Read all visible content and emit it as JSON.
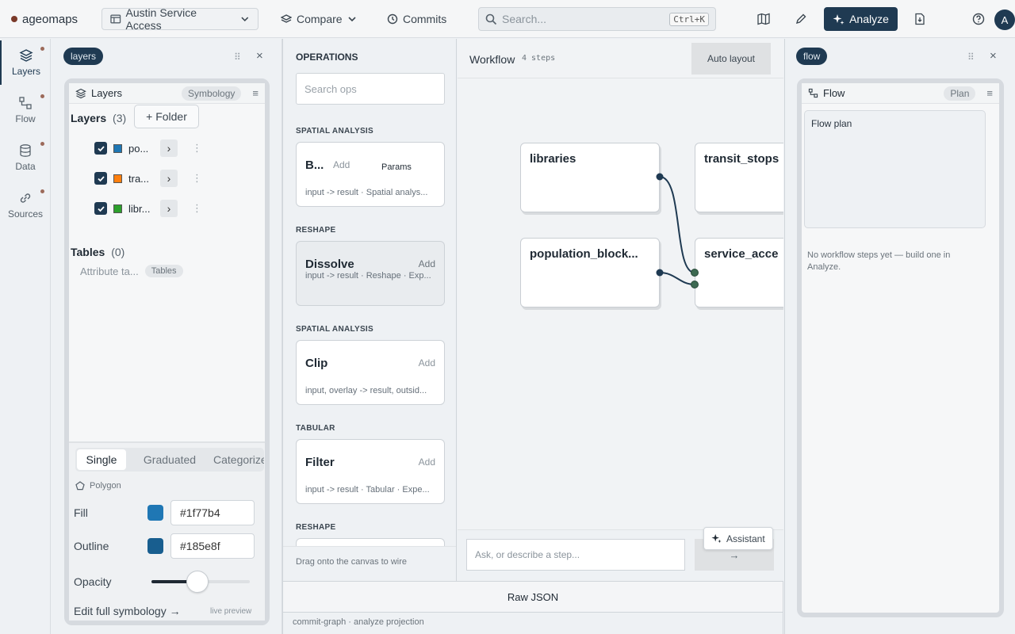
{
  "topbar": {
    "brand": "ageomaps",
    "project": "Austin Service Access",
    "compare": "Compare",
    "commits": "Commits",
    "search_placeholder": "Search...",
    "search_shortcut": "Ctrl+K",
    "analyze": "Analyze",
    "avatar": "A"
  },
  "rail": {
    "items": [
      {
        "label": "Layers",
        "icon": "layers-icon"
      },
      {
        "label": "Flow",
        "icon": "flow-icon"
      },
      {
        "label": "Data",
        "icon": "database-icon"
      },
      {
        "label": "Sources",
        "icon": "link-icon"
      }
    ]
  },
  "layers_panel": {
    "tab": "layers",
    "title": "Layers",
    "symbology_tag": "Symbology",
    "layers_heading": "Layers",
    "layers_count": "(3)",
    "folder_button": "+ Folder",
    "layers": [
      {
        "name": "po...",
        "color": "#1f77b4"
      },
      {
        "name": "tra...",
        "color": "#ff7f0e"
      },
      {
        "name": "libr...",
        "color": "#2ca02c"
      }
    ],
    "tables_heading": "Tables",
    "tables_count": "(0)",
    "attribute_label": "Attribute ta...",
    "tables_tag": "Tables",
    "symbology_tabs": [
      "Single",
      "Graduated",
      "Categorize"
    ],
    "geometry": "Polygon",
    "fill_label": "Fill",
    "fill_color": "#1f77b4",
    "fill_hex": "#1f77b4",
    "outline_label": "Outline",
    "outline_color": "#185e8f",
    "outline_hex": "#185e8f",
    "opacity_label": "Opacity",
    "opacity_value": 0.47,
    "edit_link": "Edit full symbology →",
    "live_preview": "live preview"
  },
  "operations": {
    "heading": "OPERATIONS",
    "search_placeholder": "Search ops",
    "items": [
      {
        "section": "SPATIAL ANALYSIS",
        "title": "B...",
        "add": "Add",
        "extra": "Params",
        "desc": "input -> result · Spatial analys..."
      },
      {
        "section": "RESHAPE",
        "title": "Dissolve",
        "add": "Add",
        "desc": "input -> result · Reshape · Exp..."
      },
      {
        "section": "SPATIAL ANALYSIS",
        "title": "Clip",
        "add": "Add",
        "desc": "input, overlay -> result, outsid..."
      },
      {
        "section": "TABULAR",
        "title": "Filter",
        "add": "Add",
        "desc": "input -> result · Tabular · Expe..."
      },
      {
        "section": "RESHAPE",
        "title": "",
        "add": "",
        "desc": ""
      }
    ],
    "hint": "Drag onto the canvas to wire"
  },
  "workflow": {
    "title": "Workflow",
    "steps": "4 steps",
    "auto_layout": "Auto layout",
    "nodes": [
      "libraries",
      "transit_stops",
      "population_block...",
      "service_acce"
    ],
    "assistant": "Assistant",
    "input_placeholder": "Ask, or describe a step...",
    "send": "→",
    "raw_json": "Raw JSON"
  },
  "flow_panel": {
    "tab": "flow",
    "title": "Flow",
    "plan_tag": "Plan",
    "plan_heading": "Flow plan",
    "empty_message": "No workflow steps yet — build one in Analyze."
  },
  "footer": {
    "status": "commit-graph · analyze projection"
  }
}
